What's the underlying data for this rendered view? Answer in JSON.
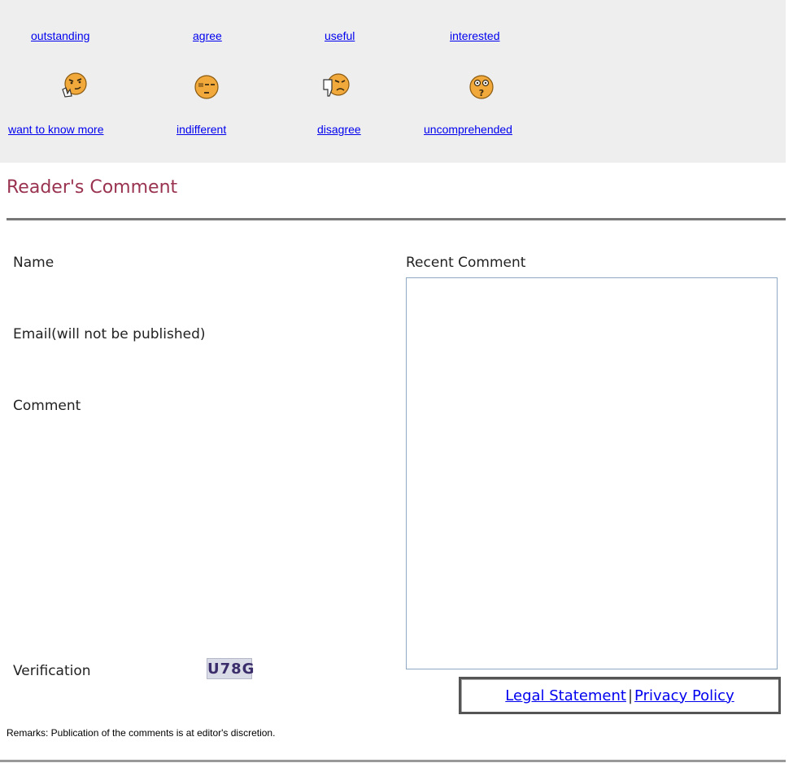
{
  "reactions": {
    "row1": [
      {
        "label": "outstanding",
        "icon": "smirk-face-icon"
      },
      {
        "label": "agree",
        "icon": "neutral-face-icon"
      },
      {
        "label": "useful",
        "icon": "thumbs-down-face-icon"
      },
      {
        "label": "interested",
        "icon": "confused-face-icon"
      }
    ],
    "row2": [
      {
        "label": "want to know more"
      },
      {
        "label": "indifferent"
      },
      {
        "label": "disagree"
      },
      {
        "label": "uncomprehended"
      }
    ]
  },
  "comment_section": {
    "title": "Reader's Comment",
    "name_label": "Name",
    "email_label": "Email(will not be published)",
    "comment_label": "Comment",
    "verification_label": "Verification",
    "captcha_text": "U78G",
    "recent_label": "Recent Comment"
  },
  "footer": {
    "legal_link": "Legal Statement ",
    "separator": "|",
    "privacy_link": "Privacy Policy",
    "remarks": "Remarks: Publication of the comments is at editor's discretion."
  },
  "colors": {
    "reaction_bg": "#eeeeee",
    "title": "#993350",
    "link": "#0000ee",
    "box_border": "#8fa9c4"
  }
}
